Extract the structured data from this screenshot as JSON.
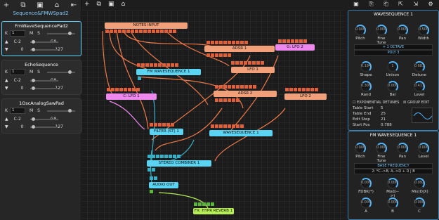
{
  "project": {
    "title": "Sequence&FMWSpad2"
  },
  "tracks": [
    {
      "name": "FmWaveSequencePad2",
      "midi_ch": "1",
      "key_lo": "C-2",
      "key_hi": "G8",
      "vel_lo": "0",
      "vel_hi": "127"
    },
    {
      "name": "EchoSequence",
      "midi_ch": "1",
      "key_lo": "C-2",
      "key_hi": "G8",
      "vel_lo": "0",
      "vel_hi": "127"
    },
    {
      "name": "1OscAnalogSawPad",
      "midi_ch": "1",
      "key_lo": "C-2",
      "key_hi": "G8",
      "vel_lo": "0",
      "vel_hi": "127"
    }
  ],
  "modules": {
    "notes_input": "NOTES INPUT",
    "adsr1": "ADSR 1",
    "lfo2_top": "G: LFO 2",
    "lfo1": "LFO 1",
    "fm_wave": "FM WAVESEQUENCE 1",
    "adsr2": "ADSR 2",
    "lfo1c": "C: LFO 1",
    "lfo2": "LFO 2",
    "filter": "FILTER (ST) 1",
    "waveseq": "WAVESEQUENCE 1",
    "stereo": "STEREO COMBINER 1",
    "audio_out": "AUDIO OUT",
    "reverb": "FX: HYPR REVERB 1"
  },
  "waveseq_panel": {
    "title": "WAVESEQUENCE 1",
    "knobs": [
      {
        "label": "Pitch",
        "value": "0.000"
      },
      {
        "label": "Fine Tune",
        "value": "0.000"
      },
      {
        "label": "Pan",
        "value": "0.000"
      },
      {
        "label": "Width",
        "value": "0.500"
      }
    ],
    "octave": "+ 1 OCTAVE",
    "poly": "POLY 3",
    "knobs2": [
      {
        "label": "Shape",
        "value": "0.194"
      },
      {
        "label": "Unison",
        "value": "1"
      },
      {
        "label": "Detune",
        "value": "0.683"
      },
      {
        "label": "Rand",
        "value": "0.300"
      },
      {
        "label": "Bal",
        "value": "0.000"
      },
      {
        "label": "Level",
        "value": "0.411"
      }
    ],
    "exp_detunes": "EXPONENTIAL DETUNES",
    "group_edit": "GROUP EDIT",
    "table_start_label": "Table Start",
    "table_start": "5",
    "table_end_label": "Table End",
    "table_end": "25",
    "edit_step_label": "Edit Step",
    "edit_step": "21",
    "start_pos_label": "Start Pos",
    "start_pos": "0.788"
  },
  "fm_panel": {
    "title": "FM WAVESEQUENCE 1",
    "knobs": [
      {
        "label": "Pitch",
        "value": "0.000"
      },
      {
        "label": "Fine Tune",
        "value": "0.000"
      },
      {
        "label": "Pan",
        "value": "0.000"
      },
      {
        "label": "Level",
        "value": "0.000"
      }
    ],
    "base_freq": "BASE FREQUENCY",
    "algo": "2: *C-->B, A-->D + D | B",
    "knobs2": [
      {
        "label": "FDBK(*)",
        "value": "0.000"
      },
      {
        "label": "Mod(-->)",
        "value": "0.000"
      },
      {
        "label": "Mix(D|X)",
        "value": "0.092"
      }
    ],
    "knobs3": [
      {
        "label": "A",
        "value": "0.000"
      },
      {
        "label": "B",
        "value": "0.000"
      },
      {
        "label": "C",
        "value": "0.000"
      }
    ]
  },
  "icons": [
    "add-icon",
    "duplicate-icon",
    "save-icon",
    "bank-icon",
    "collapse-icon"
  ]
}
